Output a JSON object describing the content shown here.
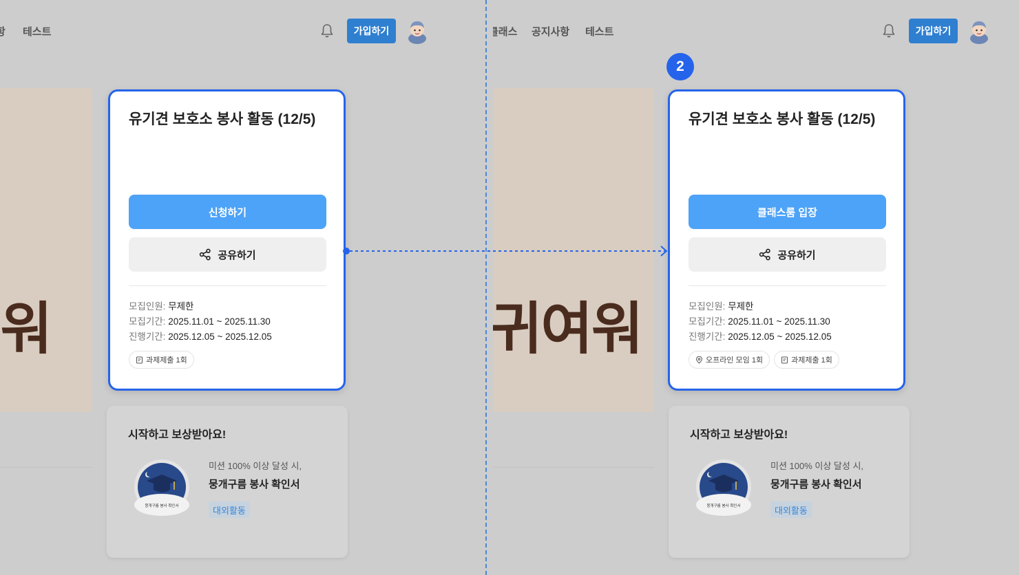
{
  "left": {
    "nav": [
      "항",
      "테스트"
    ],
    "join_label": "가입하기",
    "banner_text": "워",
    "card": {
      "title": "유기견 보호소 봉사 활동 (12/5)",
      "primary_label": "신청하기",
      "share_label": "공유하기",
      "info": [
        {
          "key": "모집인원:",
          "value": "무제한"
        },
        {
          "key": "모집기간:",
          "value": "2025.11.01 ~ 2025.11.30"
        },
        {
          "key": "진행기간:",
          "value": "2025.12.05 ~ 2025.12.05"
        }
      ],
      "tags": [
        {
          "icon": "assignment-icon",
          "label": "과제제출 1회"
        }
      ]
    },
    "reward": {
      "title": "시작하고 보상받아요!",
      "badge_text": "뭉개구름 봉사 확인서",
      "condition": "미션 100% 이상 달성 시,",
      "name": "뭉개구름 봉사 확인서",
      "tag": "대외활동"
    }
  },
  "right": {
    "nav": [
      "클래스",
      "공지사항",
      "테스트"
    ],
    "join_label": "가입하기",
    "banner_text": "귀여워",
    "step": "2",
    "card": {
      "title": "유기견 보호소 봉사 활동 (12/5)",
      "primary_label": "클래스룸 입장",
      "share_label": "공유하기",
      "info": [
        {
          "key": "모집인원:",
          "value": "무제한"
        },
        {
          "key": "모집기간:",
          "value": "2025.11.01 ~ 2025.11.30"
        },
        {
          "key": "진행기간:",
          "value": "2025.12.05 ~ 2025.12.05"
        }
      ],
      "tags": [
        {
          "icon": "location-pin-icon",
          "label": "오프라인 모임 1회"
        },
        {
          "icon": "assignment-icon",
          "label": "과제제출 1회"
        }
      ]
    },
    "reward": {
      "title": "시작하고 보상받아요!",
      "badge_text": "뭉개구름 봉사 확인서",
      "condition": "미션 100% 이상 달성 시,",
      "name": "뭉개구름 봉사 확인서",
      "tag": "대외활동"
    }
  },
  "colors": {
    "accent": "#2563eb",
    "primary_button": "#4da3f7",
    "join_button": "#2f7fd0",
    "overlay_background": "#cdcdcd"
  }
}
